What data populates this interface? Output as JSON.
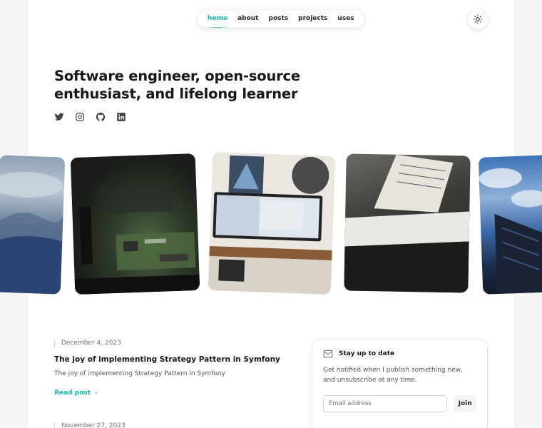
{
  "nav": {
    "items": [
      {
        "label": "home",
        "active": true
      },
      {
        "label": "about",
        "active": false
      },
      {
        "label": "posts",
        "active": false
      },
      {
        "label": "projects",
        "active": false
      },
      {
        "label": "uses",
        "active": false
      }
    ],
    "accent_color": "#14b8a6"
  },
  "theme_toggle": {
    "icon": "sun-icon"
  },
  "hero": {
    "headline": "Software engineer, open-source enthusiast, and lifelong learner",
    "socials": [
      "twitter-icon",
      "instagram-icon",
      "github-icon",
      "linkedin-icon"
    ]
  },
  "photos": [
    "mountain-landscape",
    "circuit-board",
    "desk-setup",
    "piano-keys",
    "building-sky"
  ],
  "posts": [
    {
      "date": "December 4, 2023",
      "title": "The joy of implementing Strategy Pattern in Symfony",
      "summary": "The joy of implementing Strategy Pattern in Symfony",
      "link_label": "Read post"
    },
    {
      "date": "November 27, 2023"
    }
  ],
  "newsletter": {
    "title": "Stay up to date",
    "text": "Get notified when I publish something new, and unsubscribe at any time.",
    "placeholder": "Email address",
    "button_label": "Join"
  }
}
